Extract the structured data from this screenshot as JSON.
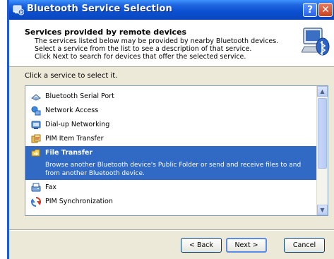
{
  "window": {
    "title": "Bluetooth Service Selection",
    "help_glyph": "?",
    "close_glyph": "✕"
  },
  "header": {
    "title": "Services provided by remote devices",
    "lines": [
      "The services listed below may be provided by nearby Bluetooth devices.",
      "Select a service from the list to see a description of that service.",
      "Click Next to search for devices that offer the selected service."
    ]
  },
  "prompt": "Click a service to select it.",
  "services": [
    {
      "label": "Bluetooth Serial Port",
      "icon": "serial-port-icon",
      "color": "#6a8fb5"
    },
    {
      "label": "Network Access",
      "icon": "network-access-icon",
      "color": "#2f7fd6"
    },
    {
      "label": "Dial-up Networking",
      "icon": "dialup-networking-icon",
      "color": "#3a78c9"
    },
    {
      "label": "PIM Item Transfer",
      "icon": "pim-transfer-icon",
      "color": "#d8a12a"
    },
    {
      "label": "File Transfer",
      "icon": "file-transfer-icon",
      "color": "#f0c23a",
      "description": "Browse another Bluetooth device's Public Folder or send and receive files to and from another Bluetooth device."
    },
    {
      "label": "Fax",
      "icon": "fax-icon",
      "color": "#4b8cd6"
    },
    {
      "label": "PIM Synchronization",
      "icon": "pim-sync-icon",
      "color": "#d23a2a"
    }
  ],
  "selected_index": 4,
  "scroll": {
    "up_glyph": "▲",
    "down_glyph": "▼"
  },
  "buttons": {
    "back": "< Back",
    "next": "Next >",
    "cancel": "Cancel"
  }
}
